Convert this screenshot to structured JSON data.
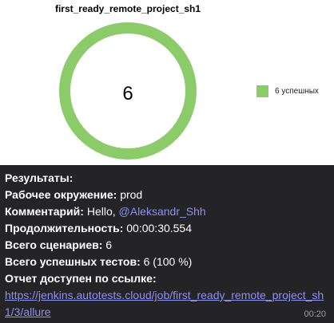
{
  "chart_data": {
    "type": "pie",
    "variant": "donut",
    "title": "first_ready_remote_project_sh1",
    "center_label": "6",
    "categories": [
      "6 успешных"
    ],
    "values": [
      6
    ],
    "colors": [
      "#8bcb6a"
    ],
    "legend_position": "right"
  },
  "message": {
    "lines": [
      {
        "label": "Результаты:",
        "value": ""
      },
      {
        "label": "Рабочее окружение:",
        "value": " prod"
      },
      {
        "label": "Комментарий:",
        "value": " Hello, "
      },
      {
        "label": "Продолжительность:",
        "value": " 00:00:30.554"
      },
      {
        "label": "Всего сценариев:",
        "value": " 6"
      },
      {
        "label": "Всего успешных тестов:",
        "value": " 6 (100 %)"
      },
      {
        "label": "Отчет доступен по ссылке:",
        "value": ""
      }
    ],
    "mention": "@Aleksandr_Shh",
    "link": "https://jenkins.autotests.cloud/job/first_ready_remote_project_sh1/3/allure",
    "time": "00:20"
  }
}
